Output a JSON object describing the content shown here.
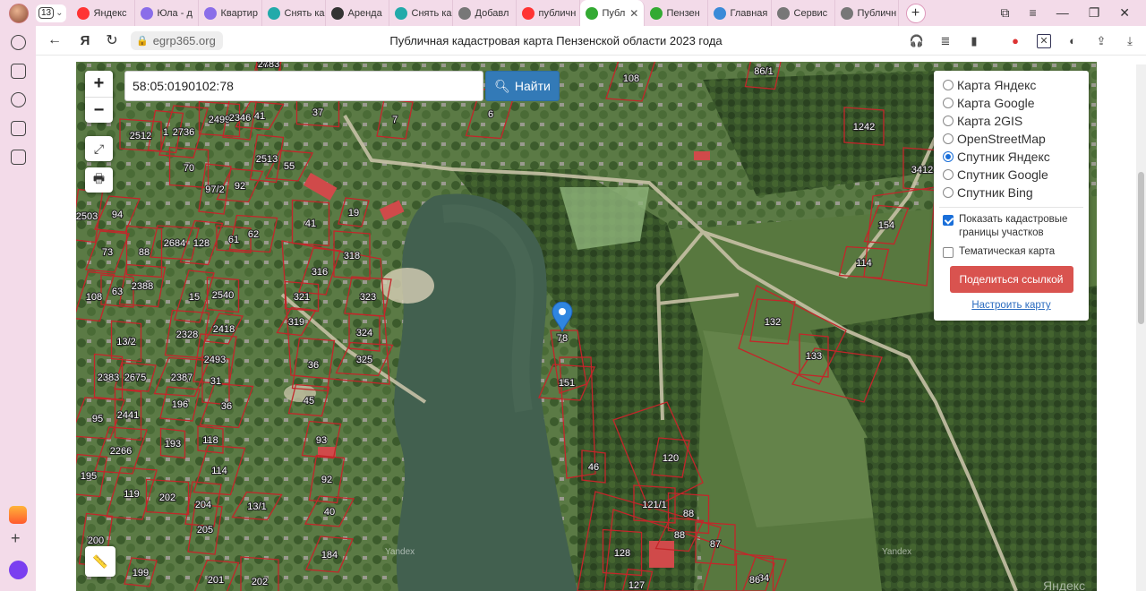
{
  "browser": {
    "tab_count": "13",
    "tabs": [
      {
        "label": "Яндекс",
        "icon": "yandex-icon",
        "color": "#f33"
      },
      {
        "label": "Юла - д",
        "icon": "sparkle-icon",
        "color": "#8a6de9"
      },
      {
        "label": "Квартир",
        "icon": "sparkle-icon",
        "color": "#8a6de9"
      },
      {
        "label": "Снять ка",
        "icon": "grid-icon",
        "color": "#2aa"
      },
      {
        "label": "Аренда",
        "icon": "moon-icon",
        "color": "#333"
      },
      {
        "label": "Снять ка",
        "icon": "grid-icon",
        "color": "#2aa"
      },
      {
        "label": "Добавл",
        "icon": "page-icon",
        "color": "#777"
      },
      {
        "label": "публичн",
        "icon": "yandex-icon",
        "color": "#f33"
      },
      {
        "label": "Публ",
        "icon": "check-icon",
        "color": "#3a3",
        "active": true
      },
      {
        "label": "Пензен",
        "icon": "check-icon",
        "color": "#3a3"
      },
      {
        "label": "Главная",
        "icon": "shield-icon",
        "color": "#3a8ad8"
      },
      {
        "label": "Сервис",
        "icon": "gear-icon",
        "color": "#777"
      },
      {
        "label": "Публичн",
        "icon": "gear-icon",
        "color": "#777"
      }
    ]
  },
  "address": {
    "domain": "egrp365.org",
    "title": "Публичная кадастровая карта Пензенской области 2023 года"
  },
  "map": {
    "search_value": "58:05:0190102:78",
    "search_button": "Найти",
    "zoom_in": "+",
    "zoom_out": "−",
    "watermark": "Yandex",
    "watermark2": "Яндекс",
    "marker_label": "78"
  },
  "layers": {
    "options": [
      {
        "label": "Карта Яндекс",
        "selected": false
      },
      {
        "label": "Карта Google",
        "selected": false
      },
      {
        "label": "Карта 2GIS",
        "selected": false
      },
      {
        "label": "OpenStreetMap",
        "selected": false
      },
      {
        "label": "Спутник Яндекс",
        "selected": true
      },
      {
        "label": "Спутник Google",
        "selected": false
      },
      {
        "label": "Спутник Bing",
        "selected": false
      }
    ],
    "show_borders": "Показать кадастровые границы участков",
    "show_borders_checked": true,
    "thematic": "Тематическая карта",
    "thematic_checked": false,
    "share_button": "Поделиться ссылкой",
    "configure_link": "Настроить карту"
  },
  "plots": [
    "2463",
    "86/1",
    "108",
    "37",
    "7",
    "6",
    "2512",
    "1",
    "2736",
    "2499",
    "2346",
    "41",
    "1242",
    "2513",
    "55",
    "70",
    "97/2",
    "92",
    "3412",
    "2503",
    "94",
    "41",
    "19",
    "154",
    "318",
    "114",
    "73",
    "88",
    "2684",
    "128",
    "61",
    "62",
    "316",
    "321",
    "323",
    "108",
    "63",
    "2388",
    "15",
    "2540",
    "132",
    "319",
    "324",
    "2328",
    "2418",
    "13/2",
    "2493",
    "325",
    "133",
    "36",
    "151",
    "2383",
    "2675",
    "2387",
    "31",
    "45",
    "95",
    "2441",
    "196",
    "36",
    "118",
    "93",
    "2266",
    "193",
    "120",
    "114",
    "46",
    "195",
    "119",
    "202",
    "204",
    "13/1",
    "121/1",
    "92",
    "40",
    "88",
    "205",
    "88",
    "87",
    "200",
    "184",
    "128",
    "199",
    "201",
    "202",
    "127",
    "84",
    "86",
    "78"
  ]
}
